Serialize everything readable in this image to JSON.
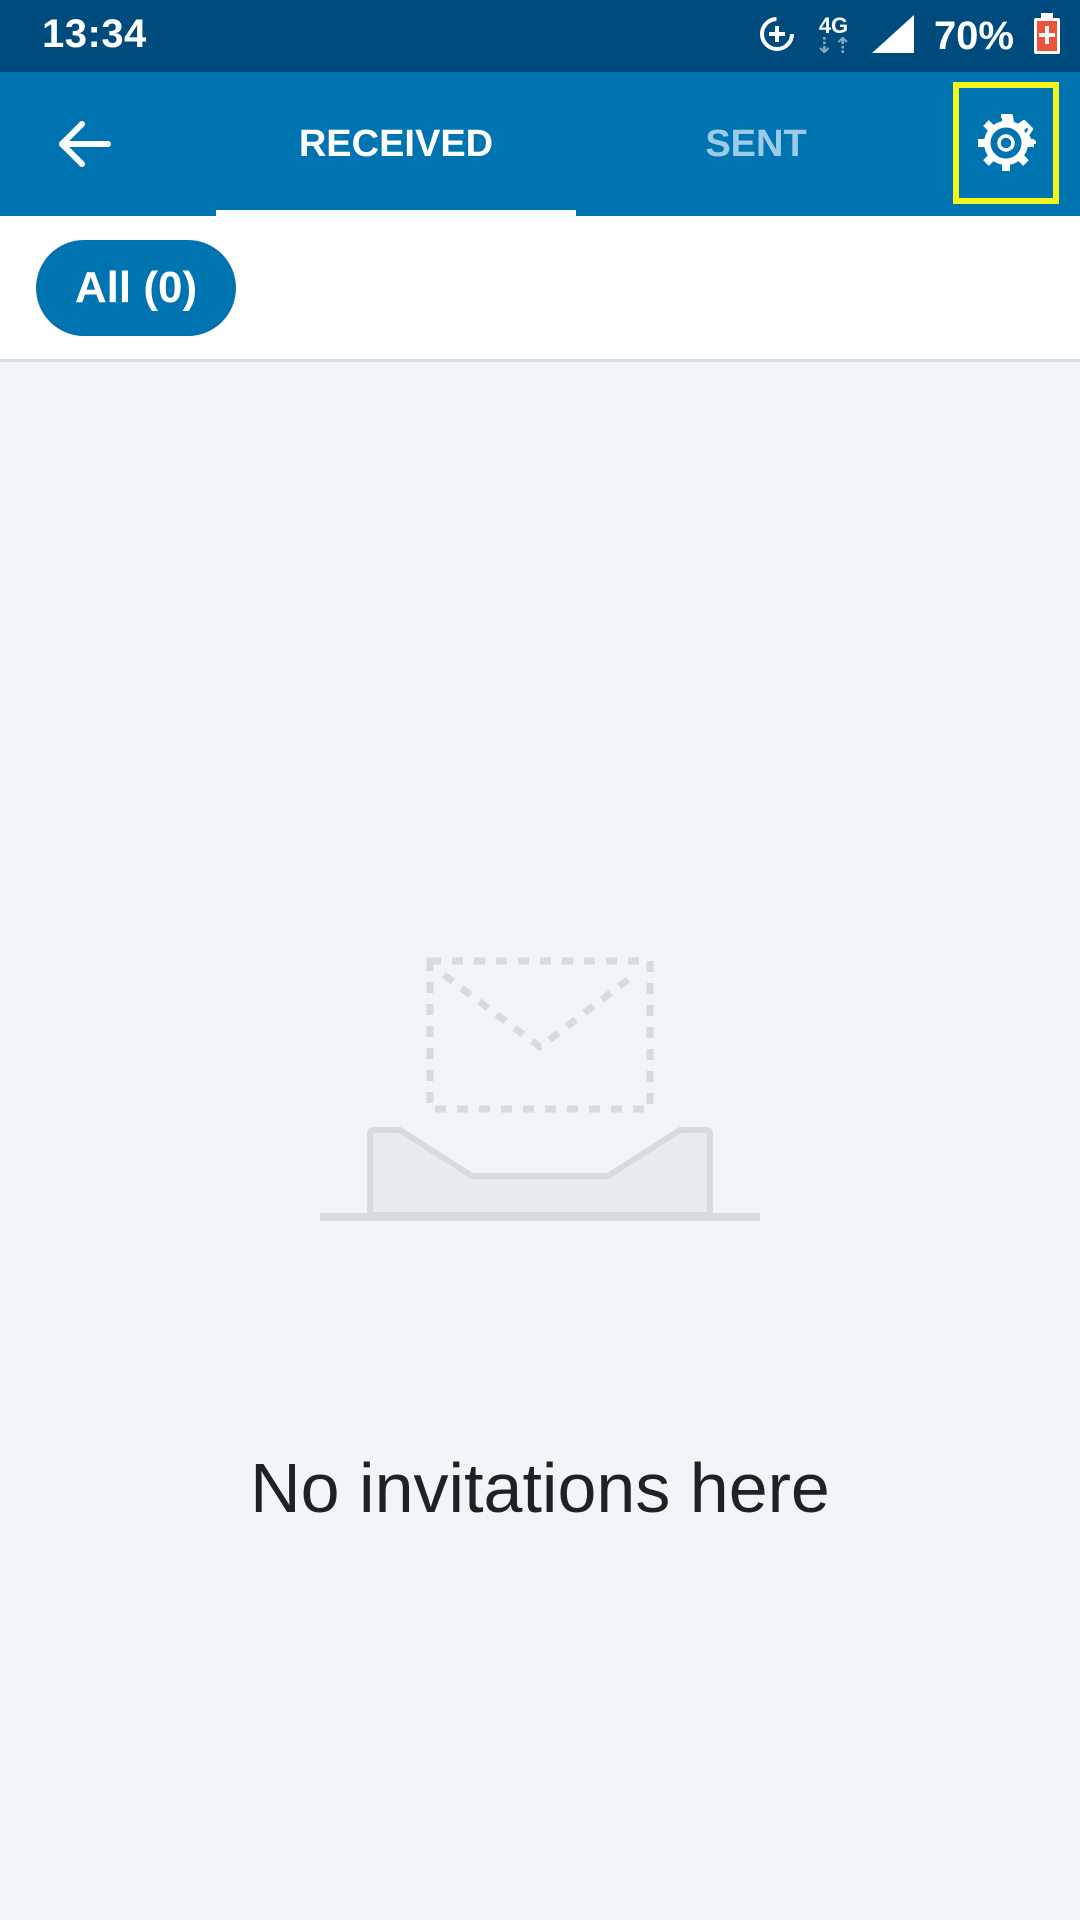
{
  "status_bar": {
    "time": "13:34",
    "network": "4G",
    "battery_percent": "70%",
    "icons": [
      "data-saver-icon",
      "network-4g-icon",
      "signal-icon",
      "battery-charging-icon"
    ]
  },
  "app_bar": {
    "back_icon": "arrow-back-icon",
    "tabs": [
      {
        "label": "RECEIVED",
        "selected": true
      },
      {
        "label": "SENT",
        "selected": false
      }
    ],
    "settings_icon": "gear-icon"
  },
  "filter": {
    "chip_label": "All (0)"
  },
  "empty_state": {
    "illustration": "empty-inbox-icon",
    "message": "No invitations here"
  },
  "colors": {
    "status_bar": "#004b7e",
    "app_bar": "#0073b1",
    "tab_inactive": "#9ccbe8",
    "highlight": "#f5f51e",
    "background": "#f2f5f8",
    "illustration": "#d5dbe0"
  }
}
